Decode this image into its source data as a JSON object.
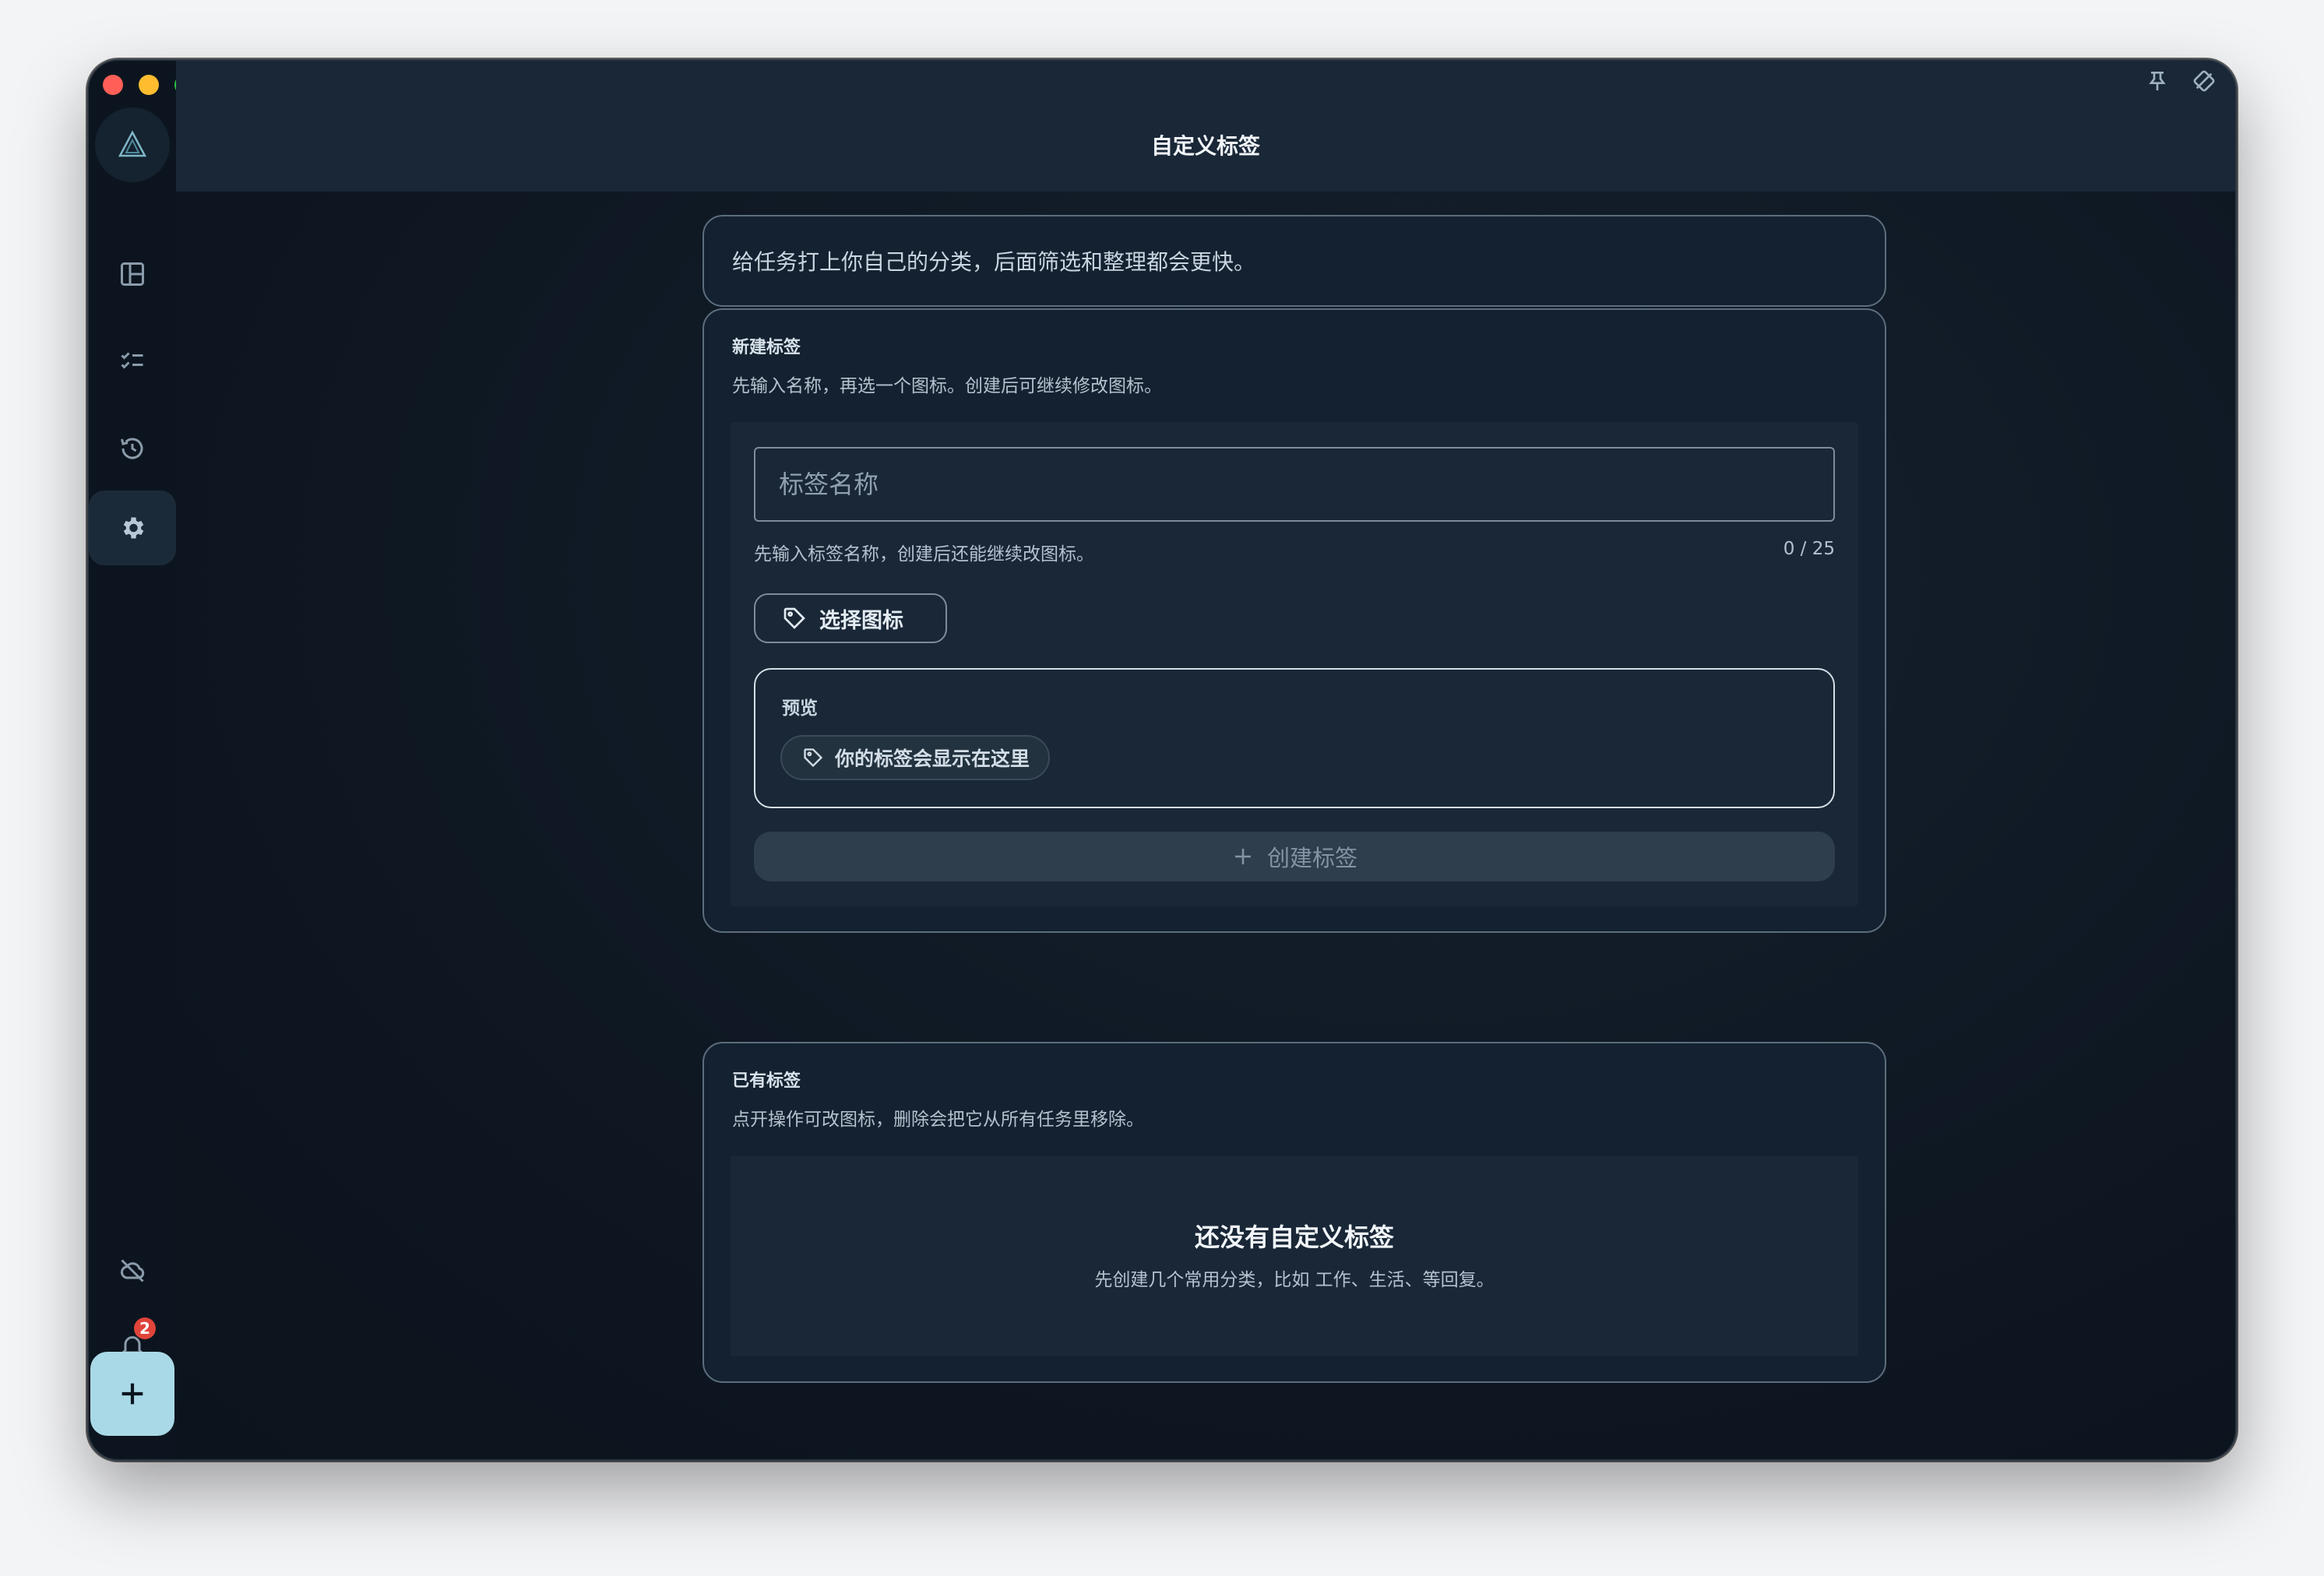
{
  "header": {
    "title": "自定义标签"
  },
  "intro": {
    "text": "给任务打上你自己的分类，后面筛选和整理都会更快。"
  },
  "new_tag": {
    "title": "新建标签",
    "subtitle": "先输入名称，再选一个图标。创建后可继续修改图标。",
    "input": {
      "placeholder": "标签名称",
      "value": ""
    },
    "hint": "先输入标签名称，创建后还能继续改图标。",
    "counter": "0 / 25",
    "choose_icon_label": "选择图标",
    "preview": {
      "label": "预览",
      "chip_text": "你的标签会显示在这里"
    },
    "create_label": "创建标签"
  },
  "existing": {
    "title": "已有标签",
    "subtitle": "点开操作可改图标，删除会把它从所有任务里移除。",
    "empty_title": "还没有自定义标签",
    "empty_subtitle": "先创建几个常用分类，比如 工作、生活、等回复。"
  },
  "notifications": {
    "count": "2"
  },
  "colors": {
    "accent": "#a9d9e6",
    "badge": "#e0443a",
    "background": "#0f1a26"
  }
}
